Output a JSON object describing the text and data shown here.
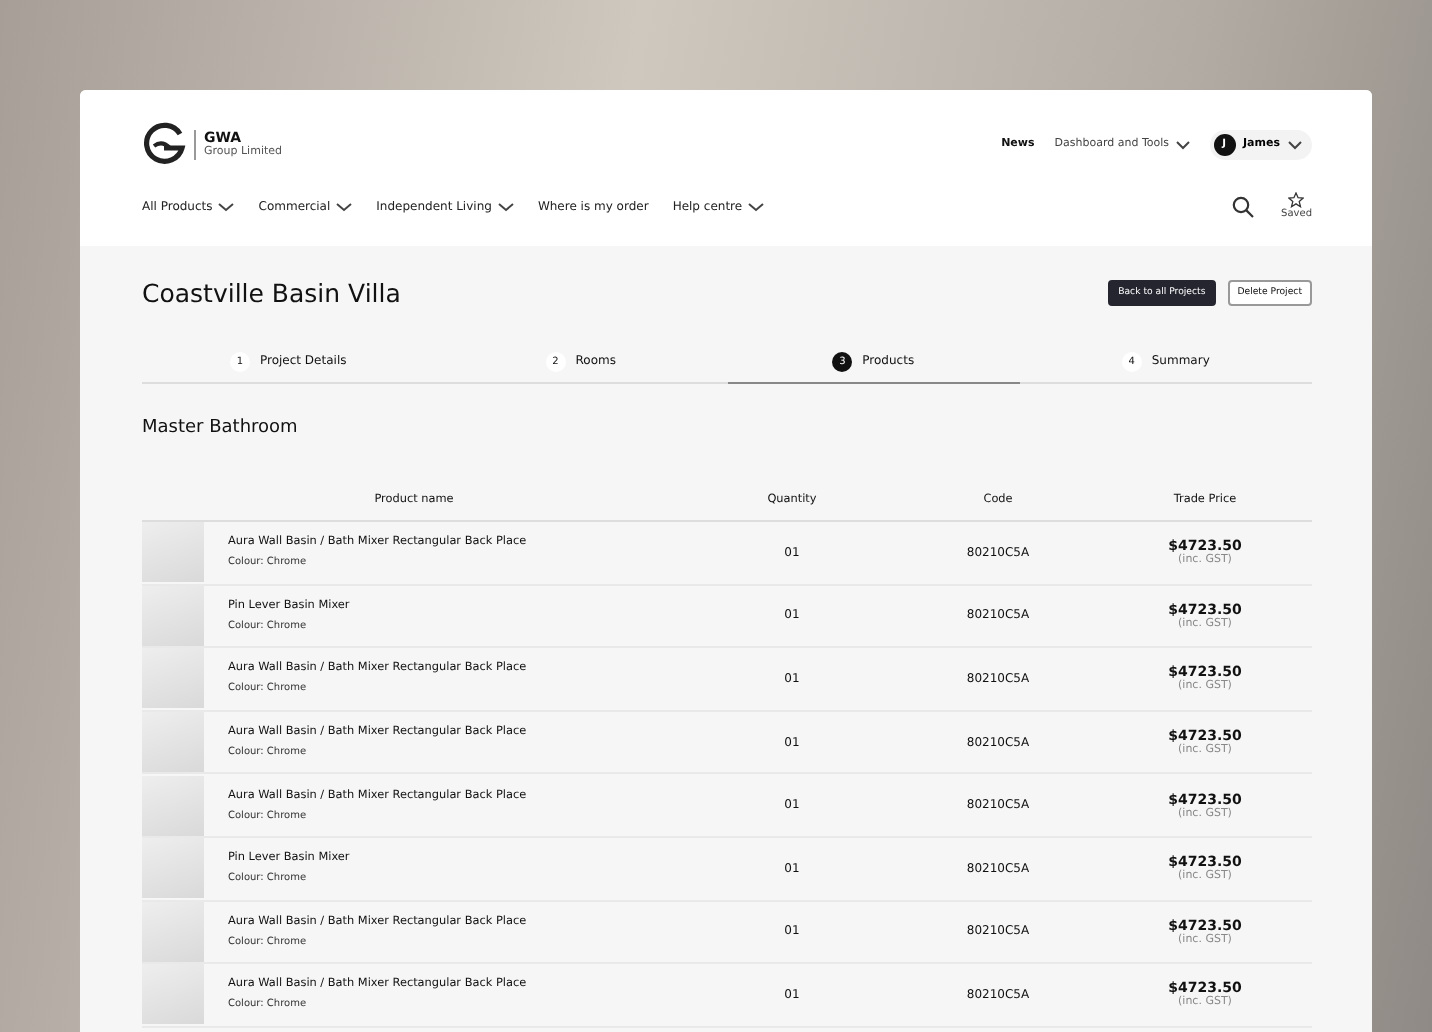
{
  "brand": {
    "name": "GWA",
    "subtitle": "Group Limited"
  },
  "top_nav": [
    {
      "label": "News",
      "dropdown": false,
      "bold": true
    },
    {
      "label": "Dashboard and Tools",
      "dropdown": true,
      "bold": false
    }
  ],
  "user": {
    "initial": "J",
    "name": "James"
  },
  "main_nav": [
    {
      "label": "All Products",
      "dropdown": true
    },
    {
      "label": "Commercial",
      "dropdown": true
    },
    {
      "label": "Independent Living",
      "dropdown": true
    },
    {
      "label": "Where is my order",
      "dropdown": false
    },
    {
      "label": "Help centre",
      "dropdown": true
    }
  ],
  "saved_label": "Saved",
  "page_title": "Coastville Basin Villa",
  "buttons": [
    {
      "label": "Back to all Projects",
      "kind": "primary"
    },
    {
      "label": "Delete Project",
      "kind": "outline"
    }
  ],
  "steps": [
    {
      "number": "1",
      "label": "Project Details",
      "selected": false
    },
    {
      "number": "2",
      "label": "Rooms",
      "selected": false
    },
    {
      "number": "3",
      "label": "Products",
      "selected": true
    },
    {
      "number": "4",
      "label": "Summary",
      "selected": false
    }
  ],
  "room_title": "Master Bathroom",
  "table": {
    "columns": [
      "Product name",
      "Quantity",
      "Code",
      "Trade Price"
    ],
    "rows": [
      {
        "name": "Aura Wall Basin / Bath Mixer Rectangular Back Place",
        "colour": "Colour: Chrome",
        "quantity": "01",
        "code": "80210C5A",
        "price": "$4723.50",
        "tax": "(inc. GST)"
      },
      {
        "name": "Pin Lever Basin Mixer",
        "colour": "Colour: Chrome",
        "quantity": "01",
        "code": "80210C5A",
        "price": "$4723.50",
        "tax": "(inc. GST)"
      },
      {
        "name": "Aura Wall Basin / Bath Mixer Rectangular Back Place",
        "colour": "Colour: Chrome",
        "quantity": "01",
        "code": "80210C5A",
        "price": "$4723.50",
        "tax": "(inc. GST)"
      },
      {
        "name": "Aura Wall Basin / Bath Mixer Rectangular Back Place",
        "colour": "Colour: Chrome",
        "quantity": "01",
        "code": "80210C5A",
        "price": "$4723.50",
        "tax": "(inc. GST)"
      },
      {
        "name": "Aura Wall Basin / Bath Mixer Rectangular Back Place",
        "colour": "Colour: Chrome",
        "quantity": "01",
        "code": "80210C5A",
        "price": "$4723.50",
        "tax": "(inc. GST)"
      },
      {
        "name": "Pin Lever Basin Mixer",
        "colour": "Colour: Chrome",
        "quantity": "01",
        "code": "80210C5A",
        "price": "$4723.50",
        "tax": "(inc. GST)"
      },
      {
        "name": "Aura Wall Basin / Bath Mixer Rectangular Back Place",
        "colour": "Colour: Chrome",
        "quantity": "01",
        "code": "80210C5A",
        "price": "$4723.50",
        "tax": "(inc. GST)"
      },
      {
        "name": "Aura Wall Basin / Bath Mixer Rectangular Back Place",
        "colour": "Colour: Chrome",
        "quantity": "01",
        "code": "80210C5A",
        "price": "$4723.50",
        "tax": "(inc. GST)"
      }
    ]
  }
}
